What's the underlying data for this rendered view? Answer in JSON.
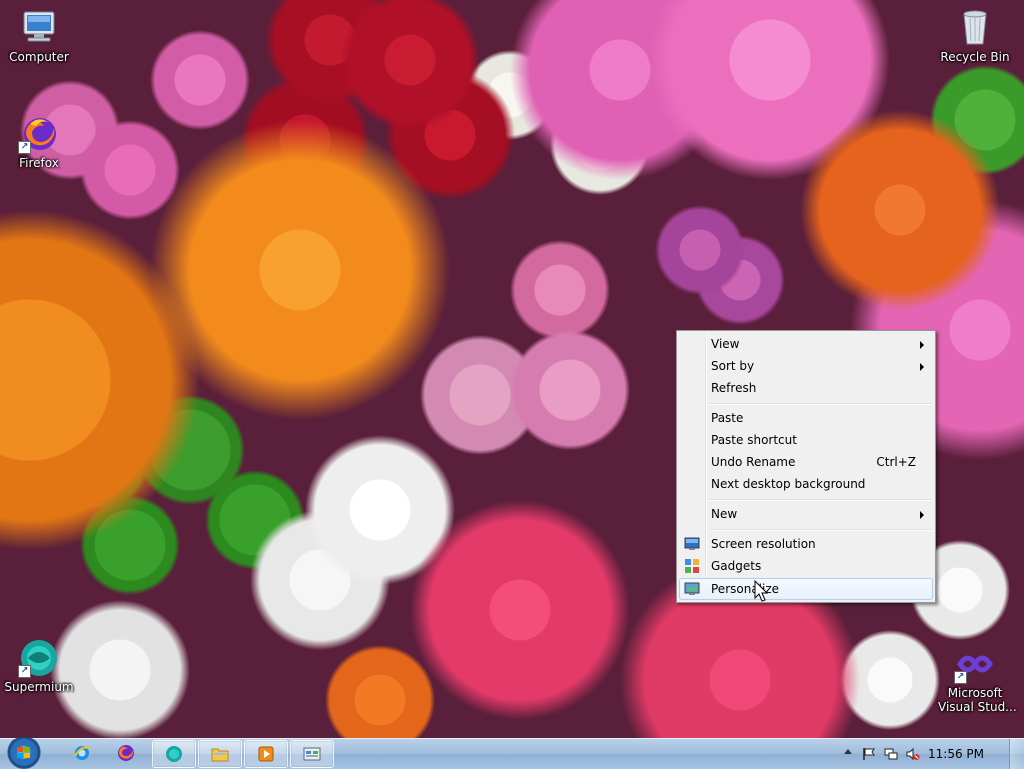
{
  "desktop": {
    "icons": [
      {
        "label": "Computer",
        "icon": "computer-icon"
      },
      {
        "label": "Firefox",
        "icon": "firefox-icon"
      },
      {
        "label": "Recycle Bin",
        "icon": "recycle-bin-icon"
      },
      {
        "label": "Supermium",
        "icon": "supermium-icon"
      },
      {
        "label": "Microsoft Visual Stud...",
        "label_line1": "Microsoft",
        "label_line2": "Visual Stud...",
        "icon": "visual-studio-icon"
      }
    ]
  },
  "context_menu": {
    "items": [
      {
        "label": "View",
        "submenu": true
      },
      {
        "label": "Sort by",
        "submenu": true
      },
      {
        "label": "Refresh"
      },
      {
        "label": "Paste"
      },
      {
        "label": "Paste shortcut"
      },
      {
        "label": "Undo Rename",
        "shortcut": "Ctrl+Z"
      },
      {
        "label": "Next desktop background"
      },
      {
        "label": "New",
        "submenu": true
      },
      {
        "label": "Screen resolution",
        "icon": "screen-resolution-icon"
      },
      {
        "label": "Gadgets",
        "icon": "gadgets-icon"
      },
      {
        "label": "Personalize",
        "icon": "personalize-icon",
        "highlighted": true
      }
    ]
  },
  "taskbar": {
    "start": "start-button",
    "pinned": [
      "internet-explorer-icon",
      "firefox-icon"
    ],
    "open": [
      "supermium-icon",
      "file-explorer-icon",
      "media-player-icon",
      "control-panel-icon"
    ],
    "tray": [
      "show-hidden-icons-arrow",
      "action-center-flag-icon",
      "network-icon",
      "volume-muted-icon"
    ],
    "clock": "11:56 PM"
  },
  "colors": {
    "menu_bg": "#f0f0f0",
    "highlight_border": "#aecff7",
    "taskbar": "#a9c4e2"
  }
}
